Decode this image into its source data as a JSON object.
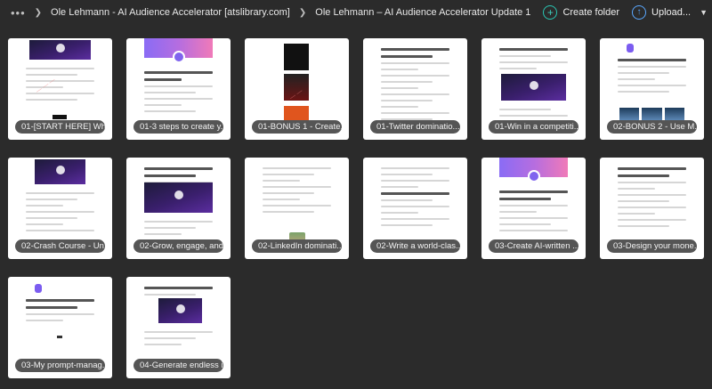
{
  "breadcrumb": {
    "more_label": "•••",
    "items": [
      "Ole Lehmann - AI Audience Accelerator [atslibrary.com]",
      "Ole Lehmann – AI Audience Accelerator Update 1"
    ]
  },
  "toolbar": {
    "create_folder_label": "Create folder",
    "upload_label": "Upload..."
  },
  "colors": {
    "accent_create": "#29c5b3",
    "accent_upload": "#5aa8ff",
    "background": "#2b2b2b"
  },
  "files": [
    {
      "name": "01-[START HERE] Wh..."
    },
    {
      "name": "01-3 steps to create y..."
    },
    {
      "name": "01-BONUS 1 - Create..."
    },
    {
      "name": "01-Twitter dominatio..."
    },
    {
      "name": "01-Win in a competiti..."
    },
    {
      "name": "02-BONUS 2 - Use M..."
    },
    {
      "name": "02-Crash Course - Un..."
    },
    {
      "name": "02-Grow, engage, and..."
    },
    {
      "name": "02-LinkedIn dominati..."
    },
    {
      "name": "02-Write a world-clas..."
    },
    {
      "name": "03-Create AI-written ..."
    },
    {
      "name": "03-Design your mone..."
    },
    {
      "name": "03-My prompt-manag..."
    },
    {
      "name": "04-Generate endless i..."
    }
  ]
}
